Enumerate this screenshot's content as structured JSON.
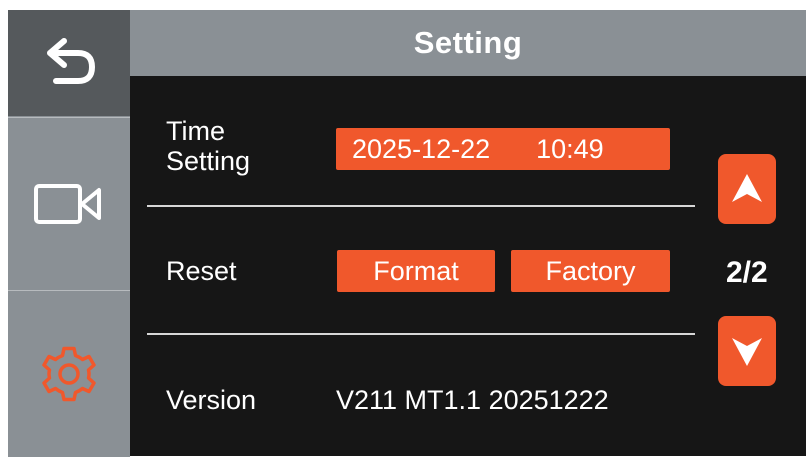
{
  "header": {
    "title": "Setting"
  },
  "sidebar": {
    "items": [
      {
        "name": "back",
        "icon": "back-arrow-icon",
        "active": true
      },
      {
        "name": "record",
        "icon": "video-camera-icon",
        "active": false
      },
      {
        "name": "settings",
        "icon": "gear-icon",
        "active": false
      }
    ]
  },
  "rows": {
    "time": {
      "label_line1": "Time",
      "label_line2": "Setting",
      "date": "2025-12-22",
      "clock": "10:49"
    },
    "reset": {
      "label": "Reset",
      "format_label": "Format",
      "factory_label": "Factory"
    },
    "version": {
      "label": "Version",
      "value": "V211 MT1.1 20251222"
    }
  },
  "pager": {
    "indicator": "2/2",
    "up_icon": "arrow-up-icon",
    "down_icon": "arrow-down-icon"
  },
  "colors": {
    "accent": "#f0582c",
    "sidebar": "#8a9095",
    "sidebar_active": "#55595c",
    "background": "#161616",
    "text": "#ffffff"
  }
}
